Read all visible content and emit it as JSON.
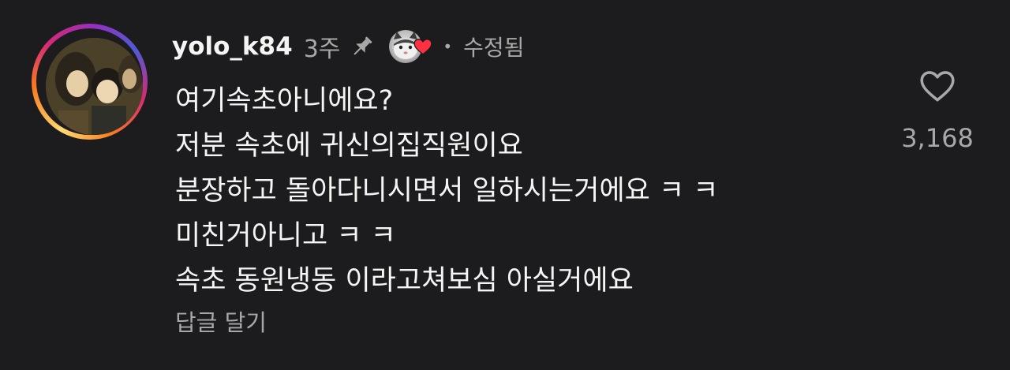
{
  "comment": {
    "username": "yolo_k84",
    "time": "3주",
    "separator": "•",
    "edited": "수정됨",
    "lines": [
      "여기속초아니에요?",
      "저분 속초에 귀신의집직원이요",
      "분장하고 돌아다니시면서 일하시는거에요 ㅋ ㅋ",
      "미친거아니고 ㅋ ㅋ",
      "속초 동원냉동 이라고쳐보심 아실거에요"
    ],
    "reply_label": "답글 달기",
    "like_count": "3,168"
  },
  "icons": {
    "pin": "pin-icon",
    "heart_outline": "heart-outline-icon",
    "author_liked": "red-heart-icon"
  },
  "colors": {
    "background": "#1c1c1e",
    "text_primary": "#f5f5f5",
    "text_secondary": "#a8a8a8",
    "heart_red": "#ff3040"
  }
}
